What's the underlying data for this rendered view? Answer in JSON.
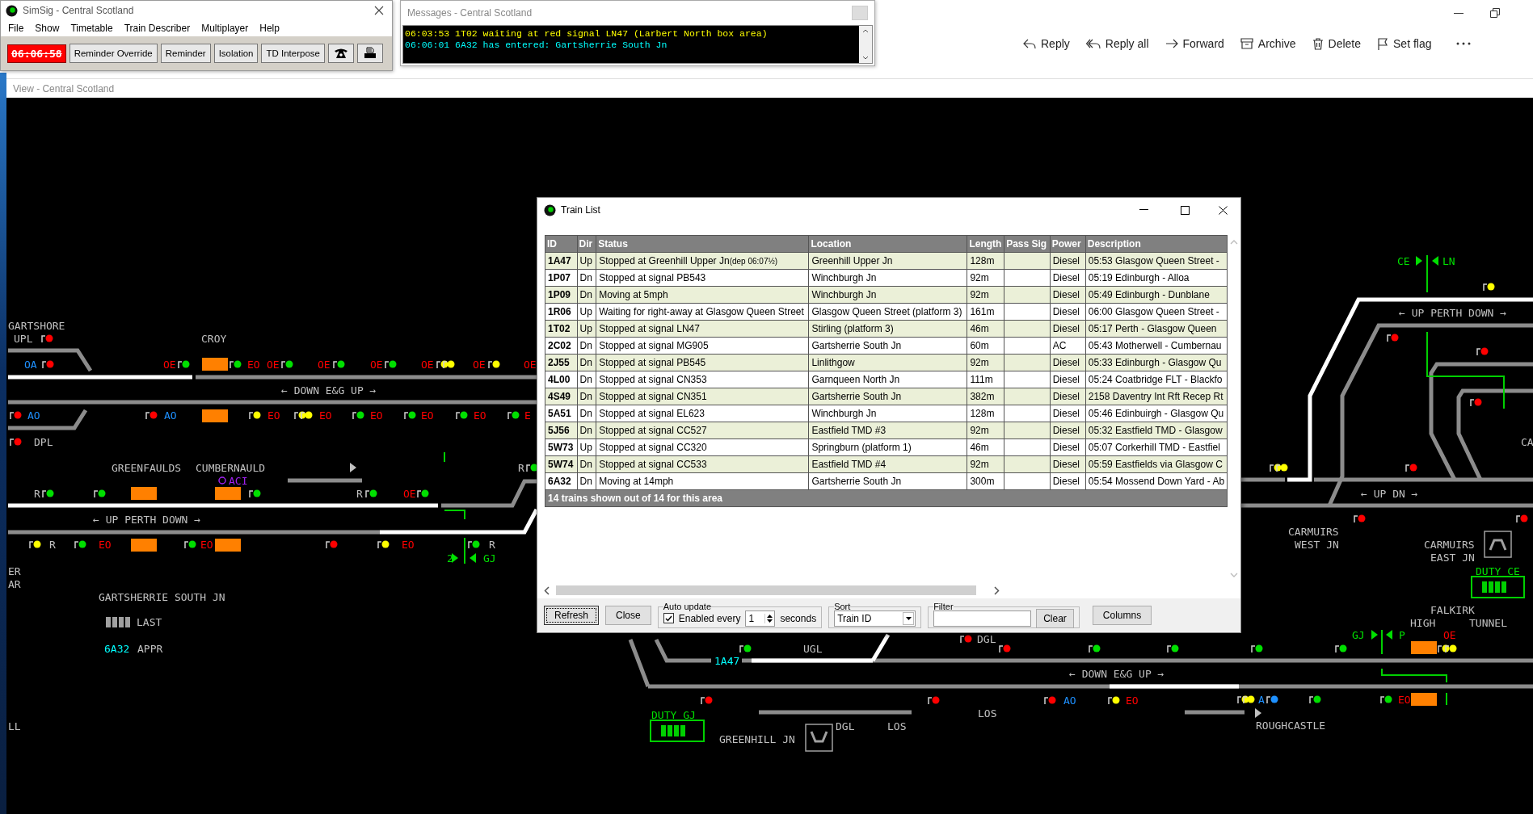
{
  "main_window": {
    "title": "SimSig - Central Scotland",
    "menu": [
      "File",
      "Show",
      "Timetable",
      "Train Describer",
      "Multiplayer",
      "Help"
    ],
    "clock": "06:06:58",
    "buttons": [
      "Reminder Override",
      "Reminder",
      "Isolation",
      "TD Interpose"
    ]
  },
  "messages_window": {
    "title": "Messages - Central Scotland",
    "messages": [
      {
        "text": "06:03:53 1T02 waiting at red signal LN47 (Larbert North box area)",
        "color": "#ffff00"
      },
      {
        "text": "06:06:01 6A32 has entered: Gartsherrie South Jn",
        "color": "#00ffff"
      }
    ]
  },
  "mail_toolbar": [
    {
      "label": "Reply",
      "kind": "reply"
    },
    {
      "label": "Reply all",
      "kind": "reply_all"
    },
    {
      "label": "Forward",
      "kind": "forward"
    },
    {
      "label": "Archive",
      "kind": "archive"
    },
    {
      "label": "Delete",
      "kind": "delete"
    },
    {
      "label": "Set flag",
      "kind": "flag"
    }
  ],
  "view_window": {
    "title": "View - Central Scotland"
  },
  "map": {
    "labels": [
      {
        "text": "GARTSHORE",
        "color": "#c0c0c0"
      },
      {
        "text": "UPL",
        "color": "#c0c0c0"
      },
      {
        "text": "CROY",
        "color": "#c0c0c0"
      },
      {
        "text": "OA",
        "color": "#1e90ff"
      },
      {
        "text": "OE",
        "color": "#ff0000"
      },
      {
        "text": "EO",
        "color": "#ff0000"
      },
      {
        "text": "OE",
        "color": "#ff0000"
      },
      {
        "text": "OE",
        "color": "#ff0000"
      },
      {
        "text": "OE",
        "color": "#ff0000"
      },
      {
        "text": "OE",
        "color": "#ff0000"
      },
      {
        "text": "OE",
        "color": "#ff0000"
      },
      {
        "text": "OE",
        "color": "#ff0000"
      },
      {
        "text": "← DOWN E&G UP →",
        "color": "#c0c0c0"
      },
      {
        "text": "AO",
        "color": "#1e90ff"
      },
      {
        "text": "AO",
        "color": "#1e90ff"
      },
      {
        "text": "EO",
        "color": "#ff0000"
      },
      {
        "text": "EO",
        "color": "#ff0000"
      },
      {
        "text": "EO",
        "color": "#ff0000"
      },
      {
        "text": "EO",
        "color": "#ff0000"
      },
      {
        "text": "EO",
        "color": "#ff0000"
      },
      {
        "text": "E",
        "color": "#ff0000"
      },
      {
        "text": "DPL",
        "color": "#c0c0c0"
      },
      {
        "text": "GREENFAULDS",
        "color": "#c0c0c0"
      },
      {
        "text": "CUMBERNAULD",
        "color": "#c0c0c0"
      },
      {
        "text": "R",
        "color": "#c0c0c0"
      },
      {
        "text": "ACI",
        "color": "#a020f0"
      },
      {
        "text": "R",
        "color": "#c0c0c0"
      },
      {
        "text": "R",
        "color": "#c0c0c0"
      },
      {
        "text": "OE",
        "color": "#ff0000"
      },
      {
        "text": "← UP PERTH DOWN →",
        "color": "#c0c0c0"
      },
      {
        "text": "R",
        "color": "#c0c0c0"
      },
      {
        "text": "EO",
        "color": "#ff0000"
      },
      {
        "text": "EO",
        "color": "#ff0000"
      },
      {
        "text": "EO",
        "color": "#ff0000"
      },
      {
        "text": "R",
        "color": "#c0c0c0"
      },
      {
        "text": "2",
        "color": "#00e000"
      },
      {
        "text": "GJ",
        "color": "#00e000"
      },
      {
        "text": "ER",
        "color": "#c0c0c0"
      },
      {
        "text": "AR",
        "color": "#c0c0c0"
      },
      {
        "text": "GARTSHERRIE SOUTH JN",
        "color": "#c0c0c0"
      },
      {
        "text": "LAST",
        "color": "#c0c0c0"
      },
      {
        "text": "6A32",
        "color": "#00ffff"
      },
      {
        "text": "APPR",
        "color": "#c0c0c0"
      },
      {
        "text": "LL",
        "color": "#c0c0c0"
      },
      {
        "text": "CE",
        "color": "#00e000"
      },
      {
        "text": "LN",
        "color": "#00e000"
      },
      {
        "text": "← UP PERTH DOWN →",
        "color": "#c0c0c0"
      },
      {
        "text": "CA",
        "color": "#c0c0c0"
      },
      {
        "text": "← UP DN →",
        "color": "#c0c0c0"
      },
      {
        "text": "CARMUIRS",
        "color": "#c0c0c0"
      },
      {
        "text": "WEST JN",
        "color": "#c0c0c0"
      },
      {
        "text": "CARMUIRS",
        "color": "#c0c0c0"
      },
      {
        "text": "EAST JN",
        "color": "#c0c0c0"
      },
      {
        "text": "DUTY CE",
        "color": "#00e000"
      },
      {
        "text": "FALKIRK",
        "color": "#c0c0c0"
      },
      {
        "text": "HIGH",
        "color": "#c0c0c0"
      },
      {
        "text": "TUNNEL",
        "color": "#c0c0c0"
      },
      {
        "text": "GJ",
        "color": "#00e000"
      },
      {
        "text": "P",
        "color": "#00e000"
      },
      {
        "text": "OE",
        "color": "#ff0000"
      },
      {
        "text": "DGL",
        "color": "#c0c0c0"
      },
      {
        "text": "UGL",
        "color": "#c0c0c0"
      },
      {
        "text": "1A47",
        "color": "#00ffff"
      },
      {
        "text": "← DOWN E&G UP →",
        "color": "#c0c0c0"
      },
      {
        "text": "AO",
        "color": "#1e90ff"
      },
      {
        "text": "EO",
        "color": "#ff0000"
      },
      {
        "text": "A",
        "color": "#1e90ff"
      },
      {
        "text": "EO",
        "color": "#ff0000"
      },
      {
        "text": "LOS",
        "color": "#c0c0c0"
      },
      {
        "text": "DUTY GJ",
        "color": "#00e000"
      },
      {
        "text": "DGL",
        "color": "#c0c0c0"
      },
      {
        "text": "LOS",
        "color": "#c0c0c0"
      },
      {
        "text": "ROUGHCASTLE",
        "color": "#c0c0c0"
      },
      {
        "text": "GREENHILL JN",
        "color": "#c0c0c0"
      }
    ],
    "signals": [
      {
        "color": "#ff0000"
      },
      {
        "color": "#ff0000"
      },
      {
        "color": "#00e000"
      },
      {
        "color": "#00e000"
      },
      {
        "color": "#00e000"
      },
      {
        "color": "#00e000"
      },
      {
        "color": "#00e000"
      },
      {
        "color": "#ffff00"
      },
      {
        "color": "#ffff00"
      },
      {
        "color": "#ffff00"
      },
      {
        "color": "#ff0000"
      },
      {
        "color": "#ff0000"
      },
      {
        "color": "#ffff00"
      },
      {
        "color": "#ffff00"
      },
      {
        "color": "#ffff00"
      },
      {
        "color": "#00e000"
      },
      {
        "color": "#00e000"
      },
      {
        "color": "#00e000"
      },
      {
        "color": "#00e000"
      },
      {
        "color": "#ff0000"
      },
      {
        "color": "#00e000"
      },
      {
        "color": "#00e000"
      },
      {
        "color": "#00e000"
      },
      {
        "color": "#00e000"
      },
      {
        "color": "#00e000"
      },
      {
        "color": "#00e000"
      },
      {
        "color": "#ffff00"
      },
      {
        "color": "#00e000"
      },
      {
        "color": "#00e000"
      },
      {
        "color": "#ff0000"
      },
      {
        "color": "#ffff00"
      },
      {
        "color": "#00e000"
      },
      {
        "color": "#ffff00"
      },
      {
        "color": "#ffff00"
      },
      {
        "color": "#ffff00"
      },
      {
        "color": "#ff0000"
      },
      {
        "color": "#ff0000"
      },
      {
        "color": "#ff0000"
      },
      {
        "color": "#ff0000"
      },
      {
        "color": "#ff0000"
      },
      {
        "color": "#ff0000"
      },
      {
        "color": "#00e000"
      },
      {
        "color": "#00e000"
      },
      {
        "color": "#ffff00"
      },
      {
        "color": "#ffff00"
      },
      {
        "color": "#ffff00"
      },
      {
        "color": "#ffff00"
      },
      {
        "color": "#00e000"
      },
      {
        "color": "#00e000"
      },
      {
        "color": "#00e000"
      },
      {
        "color": "#ff0000"
      },
      {
        "color": "#00e000"
      },
      {
        "color": "#00e000"
      },
      {
        "color": "#ff0000"
      },
      {
        "color": "#ff0000"
      },
      {
        "color": "#ff0000"
      },
      {
        "color": "#ffff00"
      },
      {
        "color": "#ff0000"
      },
      {
        "color": "#1e90ff"
      }
    ]
  },
  "train_list": {
    "title": "Train List",
    "columns": [
      "ID",
      "Dir",
      "Status",
      "Location",
      "Length",
      "Pass Sig",
      "Power",
      "Description"
    ],
    "rows": [
      {
        "id": "1A47",
        "dir": "Up",
        "status": "Stopped at Greenhill Upper Jn",
        "status_note": "(dep 06:07½)",
        "location": "Greenhill Upper Jn",
        "length": "128m",
        "power": "Diesel",
        "description": "05:53 Glasgow Queen Street -"
      },
      {
        "id": "1P07",
        "dir": "Dn",
        "status": "Stopped at signal PB543",
        "location": "Winchburgh Jn",
        "length": "92m",
        "power": "Diesel",
        "description": "05:19 Edinburgh - Alloa"
      },
      {
        "id": "1P09",
        "dir": "Dn",
        "status": "Moving at 5mph",
        "location": "Winchburgh Jn",
        "length": "92m",
        "power": "Diesel",
        "description": "05:49 Edinburgh - Dunblane"
      },
      {
        "id": "1R06",
        "dir": "Up",
        "status": "Waiting for right-away at Glasgow Queen Street",
        "location": "Glasgow Queen Street (platform 3)",
        "length": "161m",
        "power": "Diesel",
        "description": "06:00 Glasgow Queen Street -"
      },
      {
        "id": "1T02",
        "dir": "Up",
        "status": "Stopped at signal LN47",
        "location": "Stirling (platform 3)",
        "length": "46m",
        "power": "Diesel",
        "description": "05:17 Perth - Glasgow Queen"
      },
      {
        "id": "2C02",
        "dir": "Dn",
        "status": "Stopped at signal MG905",
        "location": "Gartsherrie South Jn",
        "length": "60m",
        "power": "AC",
        "description": "05:43 Motherwell - Cumbernau"
      },
      {
        "id": "2J55",
        "dir": "Dn",
        "status": "Stopped at signal PB545",
        "location": "Linlithgow",
        "length": "92m",
        "power": "Diesel",
        "description": "05:33 Edinburgh - Glasgow Qu"
      },
      {
        "id": "4L00",
        "dir": "Dn",
        "status": "Stopped at signal CN353",
        "location": "Garnqueen North Jn",
        "length": "111m",
        "power": "Diesel",
        "description": "05:24 Coatbridge FLT - Blackfo"
      },
      {
        "id": "4S49",
        "dir": "Dn",
        "status": "Stopped at signal CN351",
        "location": "Gartsherrie South Jn",
        "length": "382m",
        "power": "Diesel",
        "description": "2158 Daventry Int Rft Recep Rt"
      },
      {
        "id": "5A51",
        "dir": "Dn",
        "status": "Stopped at signal EL623",
        "location": "Winchburgh Jn",
        "length": "128m",
        "power": "Diesel",
        "description": "05:46 Edinbuirgh - Glasgow Qu"
      },
      {
        "id": "5J56",
        "dir": "Dn",
        "status": "Stopped at signal CC527",
        "location": "Eastfield TMD #3",
        "length": "92m",
        "power": "Diesel",
        "description": "05:32 Eastfield TMD - Glasgow"
      },
      {
        "id": "5W73",
        "dir": "Up",
        "status": "Stopped at signal CC320",
        "location": "Springburn (platform 1)",
        "length": "46m",
        "power": "Diesel",
        "description": "05:07 Corkerhill TMD - Eastfiel"
      },
      {
        "id": "5W74",
        "dir": "Dn",
        "status": "Stopped at signal CC533",
        "location": "Eastfield TMD #4",
        "length": "92m",
        "power": "Diesel",
        "description": "05:59 Eastfields via Glasgow C"
      },
      {
        "id": "6A32",
        "dir": "Dn",
        "status": "Moving at 14mph",
        "location": "Gartsherrie South Jn",
        "length": "300m",
        "power": "Diesel",
        "description": "05:54 Mossend Down Yard - Ab"
      }
    ],
    "summary": "14 trains shown out of 14 for this area",
    "refresh": "Refresh",
    "close": "Close",
    "auto_update": {
      "label": "Auto update",
      "checkbox_label": "Enabled every",
      "checked": true,
      "seconds": "1",
      "unit": "seconds"
    },
    "sort": {
      "label": "Sort",
      "value": "Train ID"
    },
    "filter": {
      "label": "Filter",
      "button": "Clear"
    },
    "columns_button": "Columns"
  }
}
